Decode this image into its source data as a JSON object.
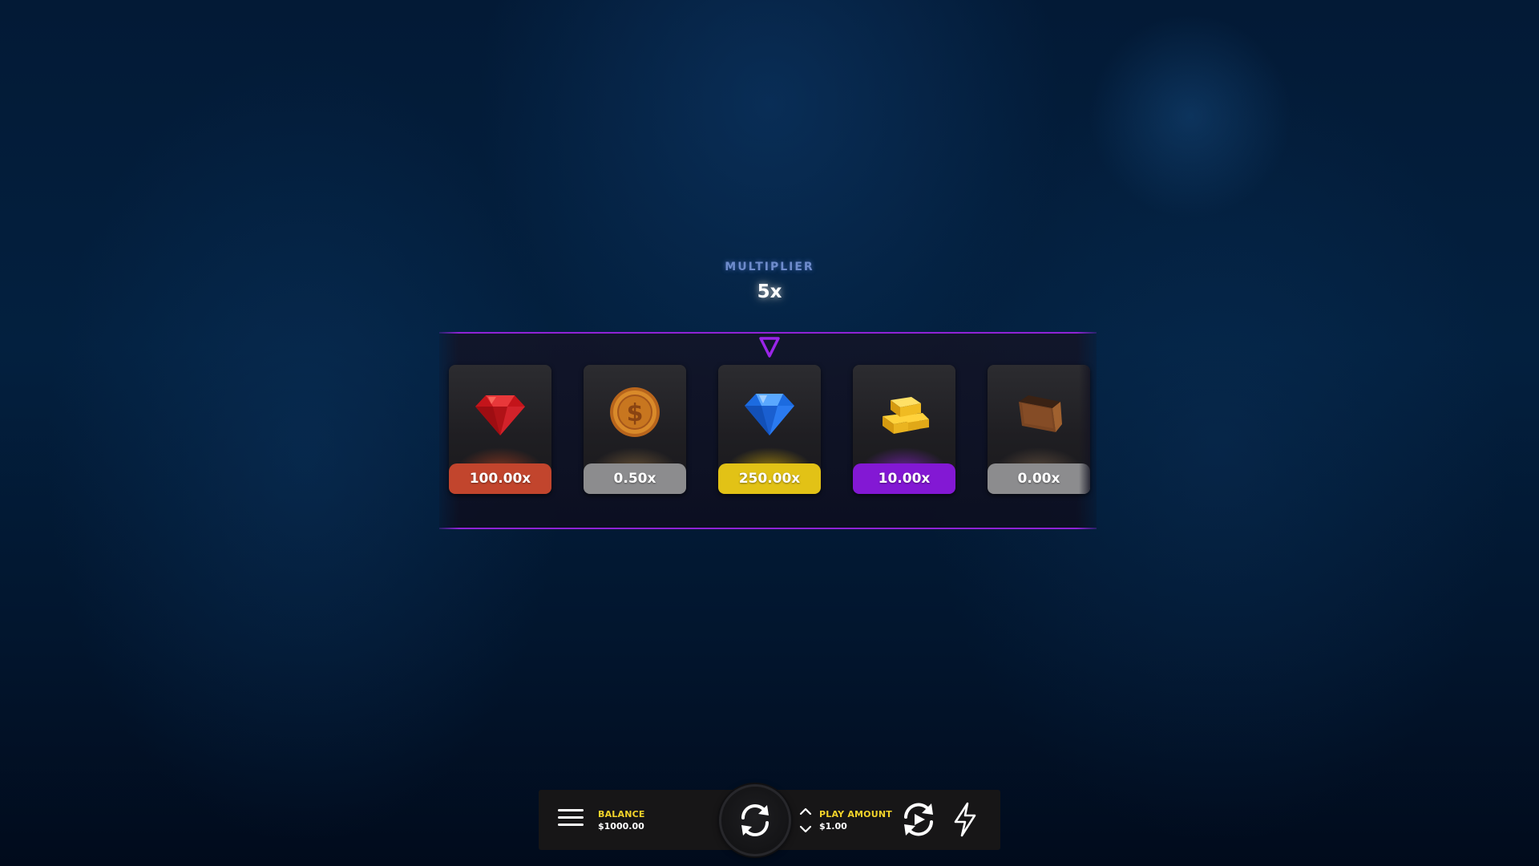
{
  "multiplier": {
    "label": "MULTIPLIER",
    "value": "5x"
  },
  "reel": {
    "cards": [
      {
        "icon": "red-gem-icon",
        "multiplier": "100.00x",
        "label_color": "#c2452d",
        "glow_color": "#d04820"
      },
      {
        "icon": "gold-coin-icon",
        "multiplier": "0.50x",
        "label_color": "#8c8c8e",
        "glow_color": "#b88a4a"
      },
      {
        "icon": "blue-diamond-icon",
        "multiplier": "250.00x",
        "label_color": "#e2c216",
        "glow_color": "#e6b800"
      },
      {
        "icon": "gold-bars-icon",
        "multiplier": "10.00x",
        "label_color": "#8318d4",
        "glow_color": "#9a25e8"
      },
      {
        "icon": "empty-wallet-icon",
        "multiplier": "0.00x",
        "label_color": "#8c8c8e",
        "glow_color": "#9c7a58"
      }
    ],
    "accent_color": "#8f23d4"
  },
  "controls": {
    "balance_label": "BALANCE",
    "balance_value": "$1000.00",
    "play_amount_label": "PLAY AMOUNT",
    "play_amount_value": "$1.00",
    "label_color": "#f2d32a"
  }
}
